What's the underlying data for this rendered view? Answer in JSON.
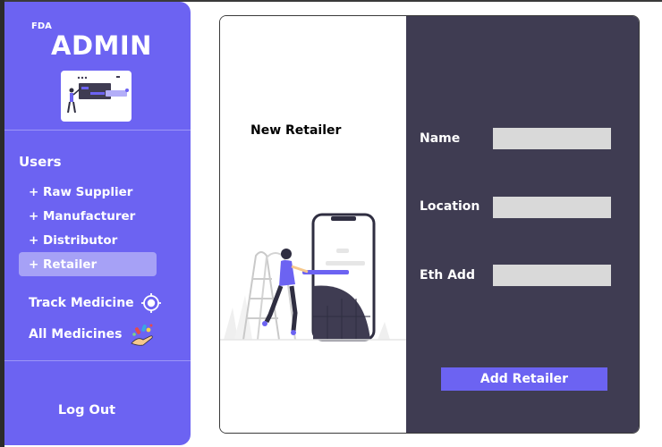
{
  "sidebar": {
    "brand_small": "FDA",
    "brand_big": "ADMIN",
    "users_heading": "Users",
    "items": [
      {
        "plus": "+",
        "label": "Raw Supplier"
      },
      {
        "plus": "+",
        "label": "Manufacturer"
      },
      {
        "plus": "+",
        "label": "Distributor"
      },
      {
        "plus": "+",
        "label": "Retailer"
      }
    ],
    "track_medicine": "Track Medicine",
    "all_medicines": "All Medicines",
    "logout": "Log Out",
    "active_item": "Retailer"
  },
  "form": {
    "title": "New Retailer",
    "fields": [
      {
        "label": "Name",
        "value": ""
      },
      {
        "label": "Location",
        "value": ""
      },
      {
        "label": "Eth Add",
        "value": ""
      }
    ],
    "submit_label": "Add Retailer"
  },
  "colors": {
    "accent": "#6c63f2",
    "panel_dark": "#3f3c52",
    "input_bg": "#d9d9d9",
    "active_item_bg": "#a6a1f6"
  },
  "icons": {
    "track": "target-icon",
    "all_medicines": "medicine-hand-icon"
  }
}
